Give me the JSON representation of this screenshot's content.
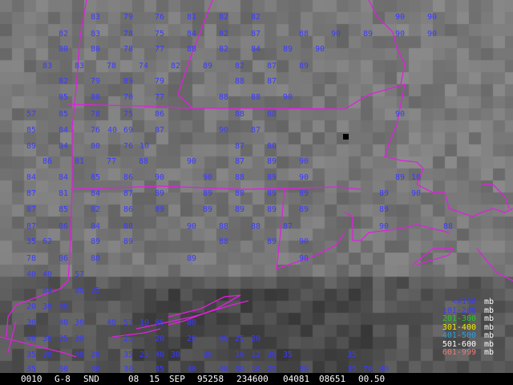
{
  "colors": {
    "border": "#e020e0",
    "bucket_lte100": "#3b3bff",
    "bucket_101_200": "#3b3bff",
    "bucket_201_300": "#22cc22",
    "bucket_301_400": "#f0f000",
    "bucket_401_500": "#2aa0e0",
    "bucket_501_600": "#ffffff",
    "bucket_601_999": "#ee7a7a"
  },
  "legend": [
    {
      "range": "<=100",
      "unit": "mb",
      "color_key": "bucket_lte100"
    },
    {
      "range": "101-200",
      "unit": "mb",
      "color_key": "bucket_101_200"
    },
    {
      "range": "201-300",
      "unit": "mb",
      "color_key": "bucket_201_300"
    },
    {
      "range": "301-400",
      "unit": "mb",
      "color_key": "bucket_301_400"
    },
    {
      "range": "401-500",
      "unit": "mb",
      "color_key": "bucket_401_500"
    },
    {
      "range": "501-600",
      "unit": "mb",
      "color_key": "bucket_501_600"
    },
    {
      "range": "601-999",
      "unit": "mb",
      "color_key": "bucket_601_999"
    }
  ],
  "status_bar": {
    "frame": "0010",
    "satellite": "G-8",
    "product": "SND",
    "field1": "08",
    "day": "15",
    "month": "SEP",
    "julian": "95258",
    "time": "234600",
    "field2": "04081",
    "field3": "08651",
    "field4": "00.50"
  },
  "rows": [
    [
      "83",
      "79",
      "76",
      "81",
      "82",
      "82",
      "90",
      "90"
    ],
    [
      "82",
      "83",
      "78",
      "75",
      "84",
      "82",
      "87",
      "88",
      "90",
      "89",
      "90",
      "90"
    ],
    [
      "80",
      "80",
      "78",
      "77",
      "88",
      "82",
      "84",
      "89",
      "90"
    ],
    [
      "83",
      "83",
      "78",
      "74",
      "82",
      "89",
      "82",
      "87",
      "89"
    ],
    [
      "82",
      "79",
      "89",
      "79",
      "88",
      "87"
    ],
    [
      "85",
      "80",
      "70",
      "77",
      "88",
      "88",
      "90"
    ],
    [
      "57",
      "85",
      "78",
      "75",
      "86",
      "88",
      "88",
      "90"
    ],
    [
      "85",
      "84",
      "76",
      "40",
      "69",
      "87",
      "90",
      "87"
    ],
    [
      "89",
      "84",
      "80",
      "76",
      "10",
      "87",
      "88"
    ],
    [
      "86",
      "81",
      "77",
      "88",
      "90",
      "87",
      "89",
      "90"
    ],
    [
      "84",
      "84",
      "85",
      "86",
      "90",
      "90",
      "88",
      "89",
      "90",
      "89",
      "10"
    ],
    [
      "87",
      "81",
      "84",
      "87",
      "89",
      "89",
      "88",
      "89",
      "89",
      "89",
      "90"
    ],
    [
      "87",
      "85",
      "82",
      "86",
      "89",
      "89",
      "89",
      "89",
      "89",
      "89"
    ],
    [
      "87",
      "86",
      "84",
      "88",
      "90",
      "88",
      "88",
      "87",
      "90",
      "88"
    ],
    [
      "35",
      "62",
      "89",
      "89",
      "88",
      "89",
      "90"
    ],
    [
      "78",
      "86",
      "88",
      "89",
      "90"
    ],
    [
      "40",
      "40",
      "57"
    ],
    [
      "83",
      "88",
      "35"
    ],
    [
      "20",
      "30",
      "40"
    ],
    [
      "30",
      "40",
      "30",
      "40",
      "57",
      "10",
      "86",
      "88"
    ],
    [
      "40",
      "30",
      "35",
      "30",
      "25",
      "20",
      "20",
      "40",
      "25",
      "20"
    ],
    [
      "35",
      "30",
      "40",
      "20",
      "35",
      "25",
      "40",
      "30",
      "30",
      "10",
      "12",
      "30",
      "35",
      "35"
    ],
    [
      "35",
      "30",
      "30",
      "30",
      "35",
      "40",
      "40",
      "30",
      "10",
      "25",
      "30",
      "35",
      "70",
      "40"
    ]
  ]
}
